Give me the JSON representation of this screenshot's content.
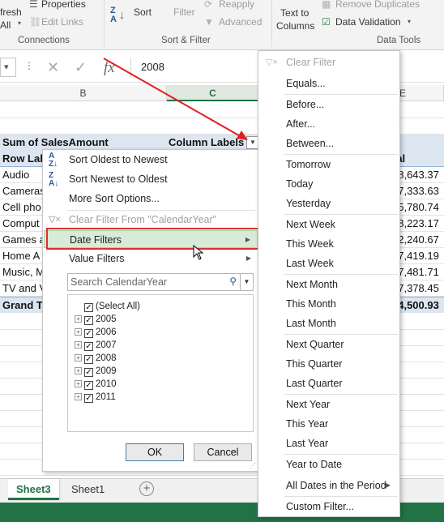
{
  "ribbon": {
    "refresh_partial": "fresh",
    "refresh_all_partial": "All",
    "properties": "Properties",
    "edit_links": "Edit Links",
    "connections_group": "Connections",
    "sort": "Sort",
    "filter": "Filter",
    "reapply": "Reapply",
    "advanced": "Advanced",
    "sort_filter_group": "Sort & Filter",
    "text_to_columns_1": "Text to",
    "text_to_columns_2": "Columns",
    "remove_duplicates": "Remove Duplicates",
    "data_validation": "Data Validation",
    "data_tools_group": "Data Tools"
  },
  "formula_bar": {
    "name_box": "",
    "value": "2008"
  },
  "columns": [
    "B",
    "C",
    "E"
  ],
  "pivot": {
    "header_value": "Sum of SalesAmount",
    "column_labels": "Column Labels",
    "row_labels_partial": "Row Lab",
    "grand_total_header_partial": "tal",
    "rows": [
      {
        "label": "Audio",
        "total": "78,643.37"
      },
      {
        "label": "Cameras",
        "total": "17,333.63"
      },
      {
        "label": "Cell pho",
        "total": "05,780.74"
      },
      {
        "label": "Comput",
        "total": "58,223.17"
      },
      {
        "label": "Games a",
        "total": "22,240.67"
      },
      {
        "label": "Home A",
        "total": "67,419.19"
      },
      {
        "label": "Music, M",
        "total": "27,481.71"
      },
      {
        "label": "TV and V",
        "total": "57,378.45"
      }
    ],
    "grand_total_label": "Grand T",
    "grand_total_value": "44,500.93"
  },
  "filter_panel": {
    "items": [
      {
        "label": "Sort Oldest to Newest",
        "icon": "sort-az-icon"
      },
      {
        "label": "Sort Newest to Oldest",
        "icon": "sort-za-icon"
      },
      {
        "label": "More Sort Options..."
      },
      {
        "label": "Clear Filter From \"CalendarYear\"",
        "disabled": true,
        "icon": "clear-filter-icon"
      },
      {
        "label": "Date Filters",
        "submenu": true
      },
      {
        "label": "Value Filters",
        "submenu": true
      }
    ],
    "search_placeholder": "Search CalendarYear",
    "tree": [
      {
        "label": "(Select All)",
        "checked": true
      },
      {
        "label": "2005",
        "checked": true
      },
      {
        "label": "2006",
        "checked": true
      },
      {
        "label": "2007",
        "checked": true
      },
      {
        "label": "2008",
        "checked": true
      },
      {
        "label": "2009",
        "checked": true
      },
      {
        "label": "2010",
        "checked": true
      },
      {
        "label": "2011",
        "checked": true
      }
    ],
    "ok": "OK",
    "cancel": "Cancel"
  },
  "date_filters_menu": {
    "items": [
      {
        "label": "Clear Filter",
        "disabled": true
      },
      {
        "label": "Equals..."
      },
      {
        "label": "Before..."
      },
      {
        "label": "After..."
      },
      {
        "label": "Between..."
      },
      {
        "label": "Tomorrow"
      },
      {
        "label": "Today"
      },
      {
        "label": "Yesterday"
      },
      {
        "label": "Next Week"
      },
      {
        "label": "This Week"
      },
      {
        "label": "Last Week"
      },
      {
        "label": "Next Month"
      },
      {
        "label": "This Month"
      },
      {
        "label": "Last Month"
      },
      {
        "label": "Next Quarter"
      },
      {
        "label": "This Quarter"
      },
      {
        "label": "Last Quarter"
      },
      {
        "label": "Next Year"
      },
      {
        "label": "This Year"
      },
      {
        "label": "Last Year"
      },
      {
        "label": "Year to Date"
      },
      {
        "label": "All Dates in the Period",
        "submenu": true
      },
      {
        "label": "Custom Filter..."
      }
    ]
  },
  "sheet_tabs": [
    {
      "label": "Sheet3",
      "active": true
    },
    {
      "label": "Sheet1",
      "active": false
    }
  ],
  "colors": {
    "excel_green": "#217346",
    "pivot_header": "#dce6f1",
    "highlight_box": "#d93030",
    "annotation_arrow": "#e02020"
  }
}
